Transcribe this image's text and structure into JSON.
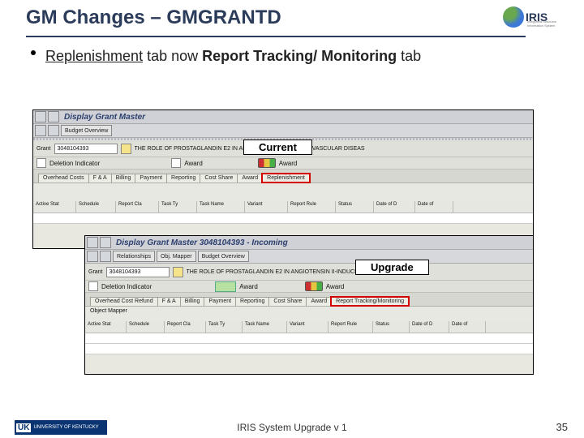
{
  "header": {
    "title": "GM Changes – GMGRANTD",
    "logo_text": "IRIS",
    "logo_sub": "Integrated Resource Information System"
  },
  "bullet": {
    "pre": "",
    "word1": "Replenishment",
    "mid": " tab now ",
    "word2": "Report Tracking/ Monitoring",
    "post": " tab"
  },
  "labels": {
    "current": "Current",
    "upgrade": "Upgrade"
  },
  "sap1": {
    "title": "Display Grant Master",
    "toolbar_btn": "Budget Overview",
    "grant_label": "Grant",
    "grant_value": "3048104393",
    "grant_desc": "THE ROLE OF PROSTAGLANDIN E2 IN ANGIOTENSIN II-INDUCED VASCULAR DISEAS",
    "status1": "Deletion Indicator",
    "status2": "Award",
    "status3": "Award",
    "tabs": [
      "Overhead Costs",
      "F & A",
      "Billing",
      "Payment",
      "Reporting",
      "Cost Share",
      "Award",
      "Replenishment"
    ],
    "grid": [
      "Active Stat",
      "Schedule",
      "Report Cla",
      "Task Ty",
      "Task Name",
      "Variant",
      "Report Rule",
      "Status",
      "Date of D",
      "Date of"
    ]
  },
  "sap2": {
    "title": "Display Grant Master 3048104393 - Incoming",
    "toolbar_btns": [
      "Relationships",
      "Obj. Mapper",
      "Budget Overview"
    ],
    "grant_label": "Grant",
    "grant_value": "3048104393",
    "grant_desc": "THE ROLE OF PROSTAGLANDIN E2 IN ANGIOTENSIN II-INDUCED VASCULAR DISEASE",
    "status1": "Deletion Indicator",
    "status2": "Award",
    "status3": "Award",
    "tabs": [
      "Overhead Cost Refund",
      "F & A",
      "Billing",
      "Payment",
      "Reporting",
      "Cost Share",
      "Award",
      "Report Tracking/Monitoring"
    ],
    "section": "Object Mapper",
    "grid": [
      "Active Stat",
      "Schedule",
      "Report Cla",
      "Task Ty",
      "Task Name",
      "Variant",
      "Report Rule",
      "Status",
      "Date of D",
      "Date of"
    ]
  },
  "footer": {
    "uk": "UK",
    "uk_text": "UNIVERSITY OF KENTUCKY",
    "center": "IRIS System Upgrade v 1",
    "page": "35"
  }
}
